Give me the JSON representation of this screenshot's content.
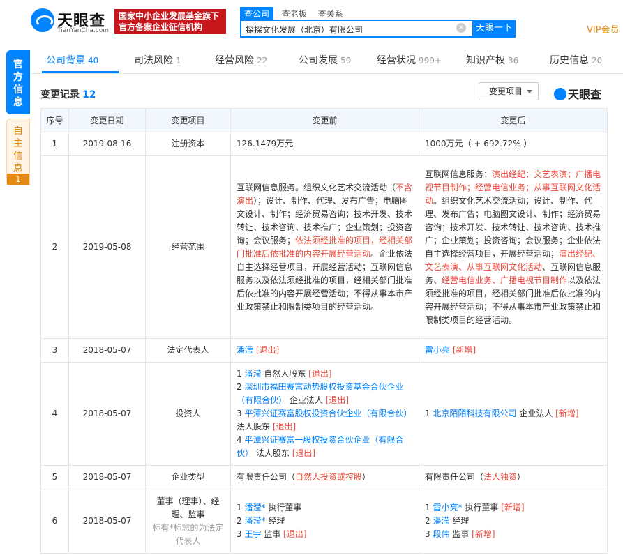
{
  "header": {
    "logo_text": "天眼查",
    "logo_sub": "TianYanCha.com",
    "slogan_line1": "国家中小企业发展基金旗下",
    "slogan_line2": "官方备案企业征信机构",
    "search_tabs": [
      "查公司",
      "查老板",
      "查关系"
    ],
    "search_value": "探探文化发展（北京）有限公司",
    "search_button": "天眼一下",
    "vip_label": "VIP会员"
  },
  "side": {
    "official_label": "官方信息",
    "self_label": "自主信息",
    "self_count": "1"
  },
  "nav": {
    "items": [
      {
        "label": "公司背景",
        "count": "40"
      },
      {
        "label": "司法风险",
        "count": "1"
      },
      {
        "label": "经营风险",
        "count": "22"
      },
      {
        "label": "公司发展",
        "count": "59"
      },
      {
        "label": "经营状况",
        "count": "999+"
      },
      {
        "label": "知识产权",
        "count": "36"
      },
      {
        "label": "历史信息",
        "count": "20"
      }
    ]
  },
  "section": {
    "title": "变更记录",
    "count": "12",
    "filter_label": "变更项目",
    "watermark": "天眼查"
  },
  "table": {
    "headers": [
      "序号",
      "变更日期",
      "变更项目",
      "变更前",
      "变更后"
    ],
    "rows": [
      {
        "no": "1",
        "date": "2019-08-16",
        "item": "注册资本",
        "before": "126.1479万元",
        "after": "1000万元（ + 692.72% ）"
      },
      {
        "no": "2",
        "date": "2019-05-08",
        "item": "经营范围",
        "before_parts": [
          "互联网信息服务。组织文化艺术交流活动（",
          "不含演出",
          "）；设计、制作、代理、发布广告；电脑图文设计、制作；经济贸易咨询；技术开发、技术转让、技术咨询、技术推广；企业策划；投资咨询；会议服务；",
          "依法须经批准的项目，经相关部门批准后依批准的内容开展经营活动",
          "。企业依法自主选择经营项目，开展经营活动；互联网信息服务以及依法须经批准的项目，经相关部门批准后依批准的内容开展经营活动；不得从事本市产业政策禁止和限制类项目的经营活动。"
        ],
        "after_parts": [
          "互联网信息服务；",
          "演出经纪；文艺表演；广播电视节目制作；经营电信业务；从事互联网文化活动",
          "。组织文化艺术交流活动；设计、制作、代理、发布广告；电脑图文设计、制作；经济贸易咨询；技术开发、技术转让、技术咨询、技术推广；企业策划；投资咨询；会议服务；企业依法自主选择经营项目，开展经营活动；",
          "演出经纪、文艺表演、从事互联网文化活动",
          "、互联网信息服务、",
          "经营电信业务、广播电视节目制作",
          "以及依法须经批准的项目，经相关部门批准后依批准的内容开展经营活动；不得从事本市产业政策禁止和限制类项目的经营活动。"
        ]
      },
      {
        "no": "3",
        "date": "2018-05-07",
        "item": "法定代表人",
        "before_name": "潘滢",
        "before_tag": "[退出]",
        "after_name": "雷小亮",
        "after_tag": "[新增]"
      },
      {
        "no": "4",
        "date": "2018-05-07",
        "item": "投资人",
        "before_list": [
          {
            "idx": "1",
            "name": "潘滢",
            "role": "自然人股东",
            "tag": "[退出]"
          },
          {
            "idx": "2",
            "name": "深圳市福田赛富动势股权投资基金合伙企业（有限合伙）",
            "role": "企业法人",
            "tag": "[退出]"
          },
          {
            "idx": "3",
            "name": "平潭兴证赛富股权投资合伙企业（有限合伙）",
            "role": "法人股东",
            "tag": "[退出]"
          },
          {
            "idx": "4",
            "name": "平潭兴证赛富一股权投资合伙企业（有限合伙）",
            "role": "法人股东",
            "tag": "[退出]"
          }
        ],
        "after_list": [
          {
            "idx": "1",
            "name": "北京陌陌科技有限公司",
            "role": "企业法人",
            "tag": "[新增]"
          }
        ]
      },
      {
        "no": "5",
        "date": "2018-05-07",
        "item": "企业类型",
        "before_plain": "有限责任公司（",
        "before_red": "自然人投资或控股",
        "before_end": "）",
        "after_plain": "有限责任公司（",
        "after_red": "法人独资",
        "after_end": "）"
      },
      {
        "no": "6",
        "date": "2018-05-07",
        "item": "董事（理事）、经理、监事",
        "item_note": "标有*标志的为法定代表人",
        "before_list": [
          {
            "idx": "1",
            "name": "潘滢*",
            "role": "执行董事",
            "tag": ""
          },
          {
            "idx": "2",
            "name": "潘滢*",
            "role": "经理",
            "tag": ""
          },
          {
            "idx": "3",
            "name": "王宇",
            "role": "监事",
            "tag": "[退出]"
          }
        ],
        "after_list": [
          {
            "idx": "1",
            "name": "雷小亮*",
            "role": "执行董事",
            "tag": "[新增]"
          },
          {
            "idx": "2",
            "name": "潘滢",
            "role": "经理",
            "tag": ""
          },
          {
            "idx": "3",
            "name": "段伟",
            "role": "监事",
            "tag": "[新增]"
          }
        ]
      }
    ]
  }
}
